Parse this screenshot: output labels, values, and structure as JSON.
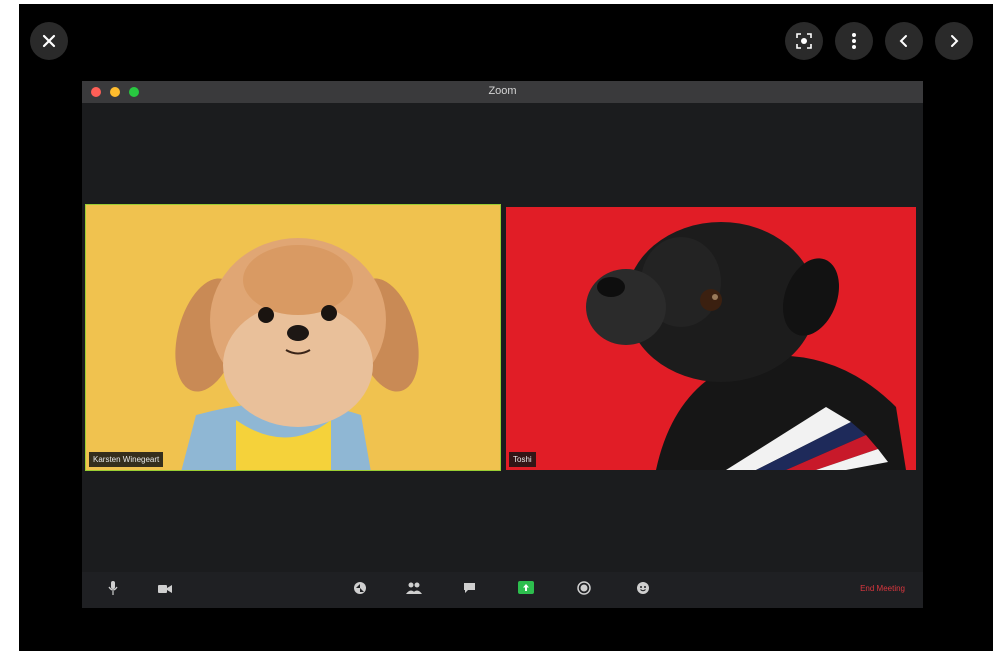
{
  "viewer": {
    "top_icons": [
      "close-icon",
      "focus-icon",
      "more-vertical-icon",
      "chevron-left-icon",
      "chevron-right-icon"
    ]
  },
  "window": {
    "title": "Zoom",
    "traffic_lights": [
      "#ff5f57",
      "#febc2e",
      "#28c840"
    ]
  },
  "participants": [
    {
      "name": "Karsten Winegeart",
      "background": "#f0c24f",
      "active_speaker": true
    },
    {
      "name": "Toshi",
      "background": "#e11d26",
      "active_speaker": false
    }
  ],
  "controls": {
    "icons": [
      "microphone-icon",
      "video-camera-icon",
      "security-icon",
      "participants-icon",
      "chat-icon",
      "share-screen-icon",
      "record-icon",
      "reactions-icon"
    ],
    "share_color": "#2dbe4e",
    "end_label": "End Meeting",
    "end_color": "#d9363e"
  }
}
